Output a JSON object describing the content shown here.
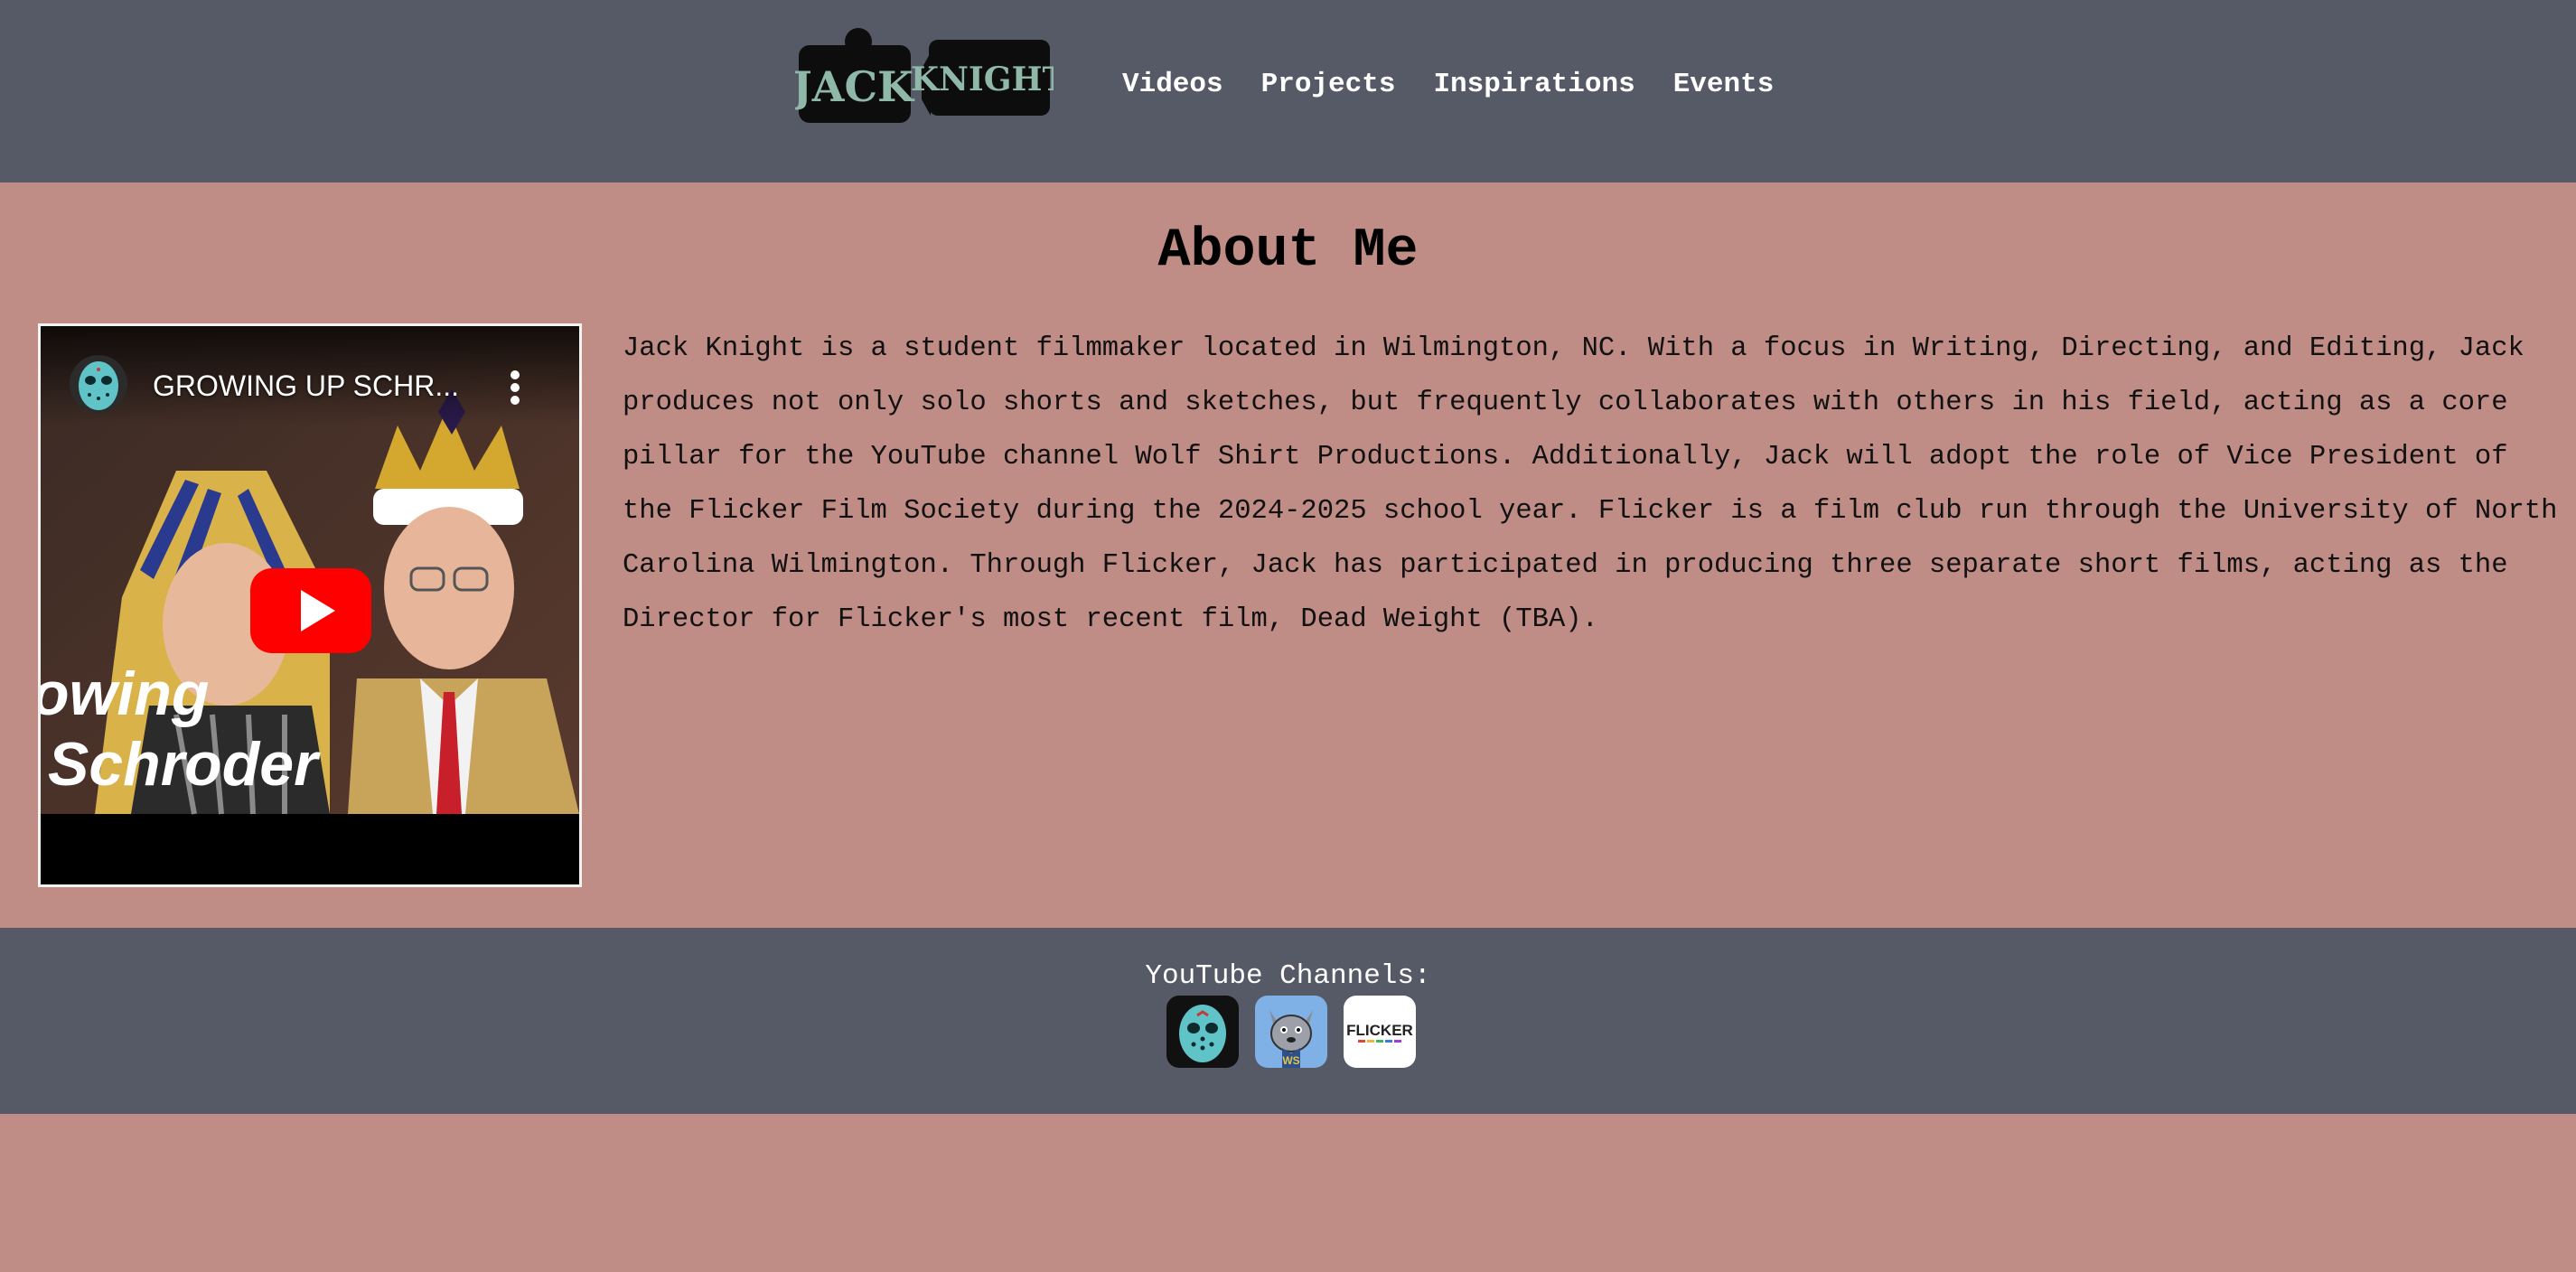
{
  "header": {
    "logo": {
      "line1": "JACK",
      "line2": "KNIGHT"
    },
    "nav": [
      {
        "label": "Videos"
      },
      {
        "label": "Projects"
      },
      {
        "label": "Inspirations"
      },
      {
        "label": "Events"
      }
    ]
  },
  "main": {
    "title": "About Me",
    "video": {
      "title": "GROWING UP SCHR...",
      "thumbnail_text_line1": "owing",
      "thumbnail_text_line2": "Schroder"
    },
    "bio": "Jack Knight is a student filmmaker located in Wilmington, NC. With a focus in Writing, Directing, and Editing, Jack produces not only solo shorts and sketches, but frequently collaborates with others in his field, acting as a core pillar for the YouTube channel Wolf Shirt Productions. Additionally, Jack will adopt the role of Vice President of the Flicker Film Society during the 2024-2025 school year. Flicker is a film club run through the University of North Carolina Wilmington. Through Flicker, Jack has participated in producing three separate short films, acting as the Director for Flicker's most recent film, Dead Weight (TBA)."
  },
  "footer": {
    "label": "YouTube Channels:",
    "channels": [
      {
        "icon": "hockey-mask-icon"
      },
      {
        "icon": "wolf-mascot-icon",
        "badge": "WS"
      },
      {
        "icon": "flicker-logo-icon",
        "logo_text": "FLICKER"
      }
    ]
  },
  "colors": {
    "header_bg": "#565a66",
    "page_bg": "#bf8c86",
    "logo_text": "#8fb8a8",
    "youtube_red": "#ff0000"
  }
}
